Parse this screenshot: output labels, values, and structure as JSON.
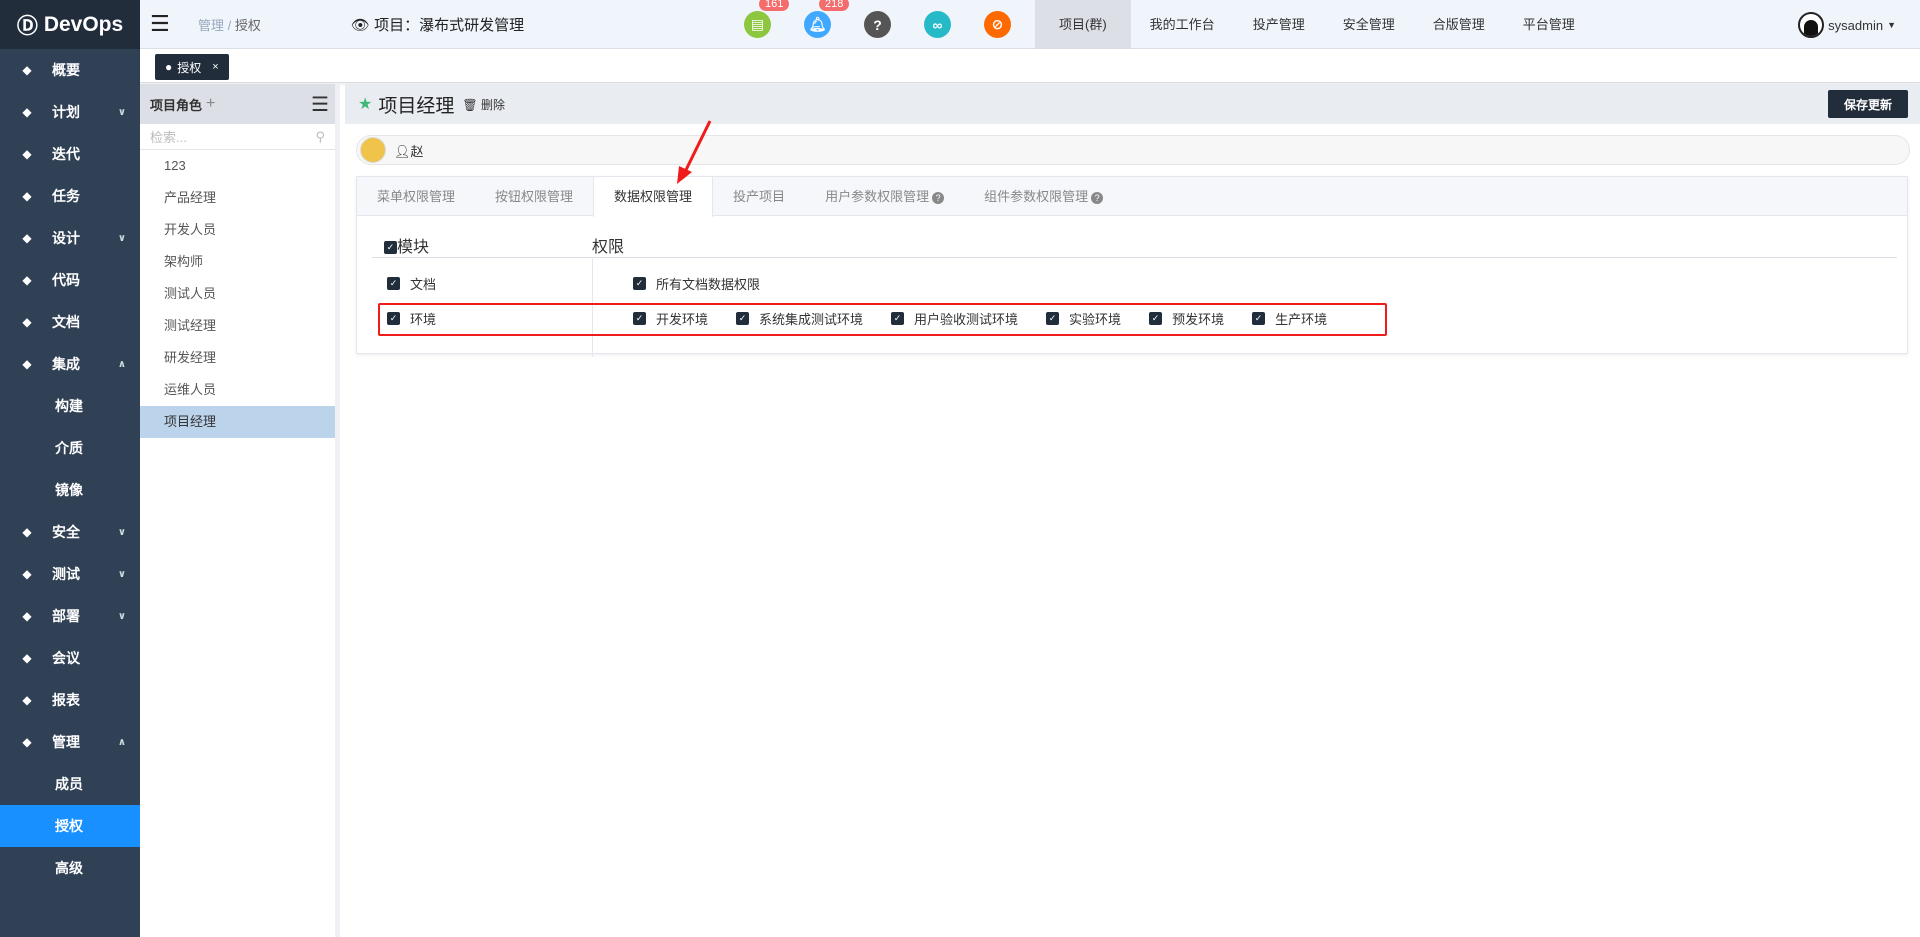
{
  "app": {
    "logo": "DevOps"
  },
  "header": {
    "breadcrumb": [
      "管理",
      "授权"
    ],
    "project_label": "项目：瀑布式研发管理",
    "badges": {
      "docs": "161",
      "bell": "218"
    },
    "nav": [
      "项目(群)",
      "我的工作台",
      "投产管理",
      "安全管理",
      "合版管理",
      "平台管理"
    ],
    "user": "sysadmin"
  },
  "sidebar": {
    "items": [
      {
        "label": "概要",
        "icon": "dashboard-icon"
      },
      {
        "label": "计划",
        "icon": "plan-icon",
        "chev": "∨"
      },
      {
        "label": "迭代",
        "icon": "iteration-icon"
      },
      {
        "label": "任务",
        "icon": "folder-icon"
      },
      {
        "label": "设计",
        "icon": "design-icon",
        "chev": "∨"
      },
      {
        "label": "代码",
        "icon": "code-icon"
      },
      {
        "label": "文档",
        "icon": "doc-icon"
      },
      {
        "label": "集成",
        "icon": "integration-icon",
        "chev": "∧"
      },
      {
        "label": "构建",
        "sub": true
      },
      {
        "label": "介质",
        "sub": true
      },
      {
        "label": "镜像",
        "sub": true
      },
      {
        "label": "安全",
        "icon": "shield-icon",
        "chev": "∨"
      },
      {
        "label": "测试",
        "icon": "flask-icon",
        "chev": "∨"
      },
      {
        "label": "部署",
        "icon": "deploy-icon",
        "chev": "∨"
      },
      {
        "label": "会议",
        "icon": "meeting-icon"
      },
      {
        "label": "报表",
        "icon": "report-icon"
      },
      {
        "label": "管理",
        "icon": "gear-icon",
        "chev": "∧"
      },
      {
        "label": "成员",
        "sub": true
      },
      {
        "label": "授权",
        "sub": true,
        "active": true
      },
      {
        "label": "高级",
        "sub": true
      }
    ]
  },
  "tagbar": {
    "tag": "授权",
    "close": "×"
  },
  "roles": {
    "title": "项目角色",
    "add": "+",
    "search_placeholder": "检索...",
    "items": [
      "123",
      "产品经理",
      "开发人员",
      "架构师",
      "测试人员",
      "测试经理",
      "研发经理",
      "运维人员",
      "项目经理"
    ],
    "active": "项目经理"
  },
  "main": {
    "title": "项目经理",
    "delete": "删除",
    "save": "保存更新",
    "member": "赵",
    "tabs": [
      {
        "label": "菜单权限管理"
      },
      {
        "label": "按钮权限管理"
      },
      {
        "label": "数据权限管理",
        "active": true
      },
      {
        "label": "投产项目"
      },
      {
        "label": "用户参数权限管理",
        "help": true
      },
      {
        "label": "组件参数权限管理",
        "help": true
      }
    ],
    "table": {
      "col_module": "模块",
      "col_perm": "权限",
      "rows": [
        {
          "module": "文档",
          "perms": [
            "所有文档数据权限"
          ]
        },
        {
          "module": "环境",
          "perms": [
            "开发环境",
            "系统集成测试环境",
            "用户验收测试环境",
            "实验环境",
            "预发环境",
            "生产环境"
          ]
        }
      ]
    }
  },
  "colors": {
    "sidebar": "#304156",
    "active": "#1890ff",
    "highlight": "#f01c1c"
  }
}
